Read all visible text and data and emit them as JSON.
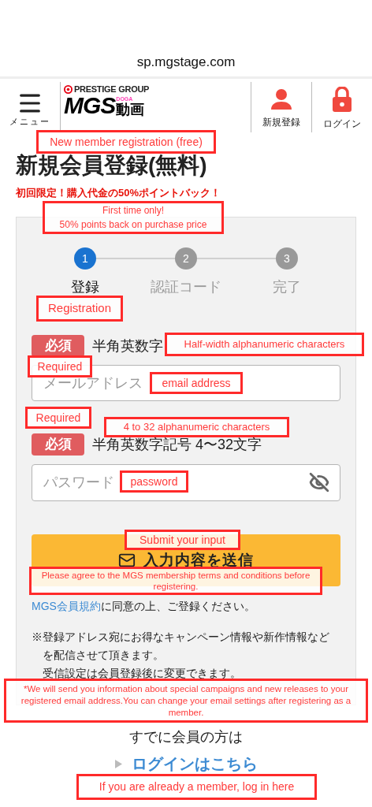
{
  "browser": {
    "url": "sp.mgstage.com"
  },
  "header": {
    "menu_label": "メニュー",
    "logo": {
      "group": "PRESTIGE GROUP",
      "name": "MGS",
      "sub": "DOGA",
      "kanji": "動画"
    },
    "actions": [
      {
        "kind": "register",
        "label": "新規登録"
      },
      {
        "kind": "login",
        "label": "ログイン"
      }
    ]
  },
  "title": "新規会員登録(無料)",
  "promo": "初回限定！購入代金の50%ポイントバック！",
  "steps": [
    {
      "number": "1",
      "label": "登録",
      "selected": true
    },
    {
      "number": "2",
      "label": "認証コード",
      "selected": false
    },
    {
      "number": "3",
      "label": "完了",
      "selected": false
    }
  ],
  "fields": [
    {
      "badge": "必須",
      "hint": "半角英数字",
      "placeholder": "メールアドレス",
      "kind": "email"
    },
    {
      "badge": "必須",
      "hint": "半角英数字記号 4〜32文字",
      "placeholder": "パスワード",
      "kind": "password"
    }
  ],
  "submit_button": "入力内容を送信",
  "terms": {
    "link": "MGS会員規約",
    "text": "に同意の上、ご登録ください。"
  },
  "notes": [
    "※登録アドレス宛にお得なキャンペーン情報や新作情報などを配信させて頂きます。",
    "受信設定は会員登録後に変更できます。"
  ],
  "member_prompt": "すでに会員の方は",
  "login_link": "ログインはこちら",
  "annotations": [
    {
      "text": "New member registration (free)"
    },
    {
      "text": "First time only!\n50% points back on purchase price"
    },
    {
      "text": "Registration"
    },
    {
      "text": "Half-width alphanumeric characters"
    },
    {
      "text": "Required"
    },
    {
      "text": "email address"
    },
    {
      "text": "Required"
    },
    {
      "text": "4 to 32 alphanumeric characters"
    },
    {
      "text": "password"
    },
    {
      "text": "Submit your input"
    },
    {
      "text": "Please agree to the MGS membership terms and conditions before registering."
    },
    {
      "text": "*We will send you information about special campaigns and new releases to your registered email address.You can change your email settings after registering as a member."
    },
    {
      "text": "If you are already a member, log in here"
    }
  ]
}
